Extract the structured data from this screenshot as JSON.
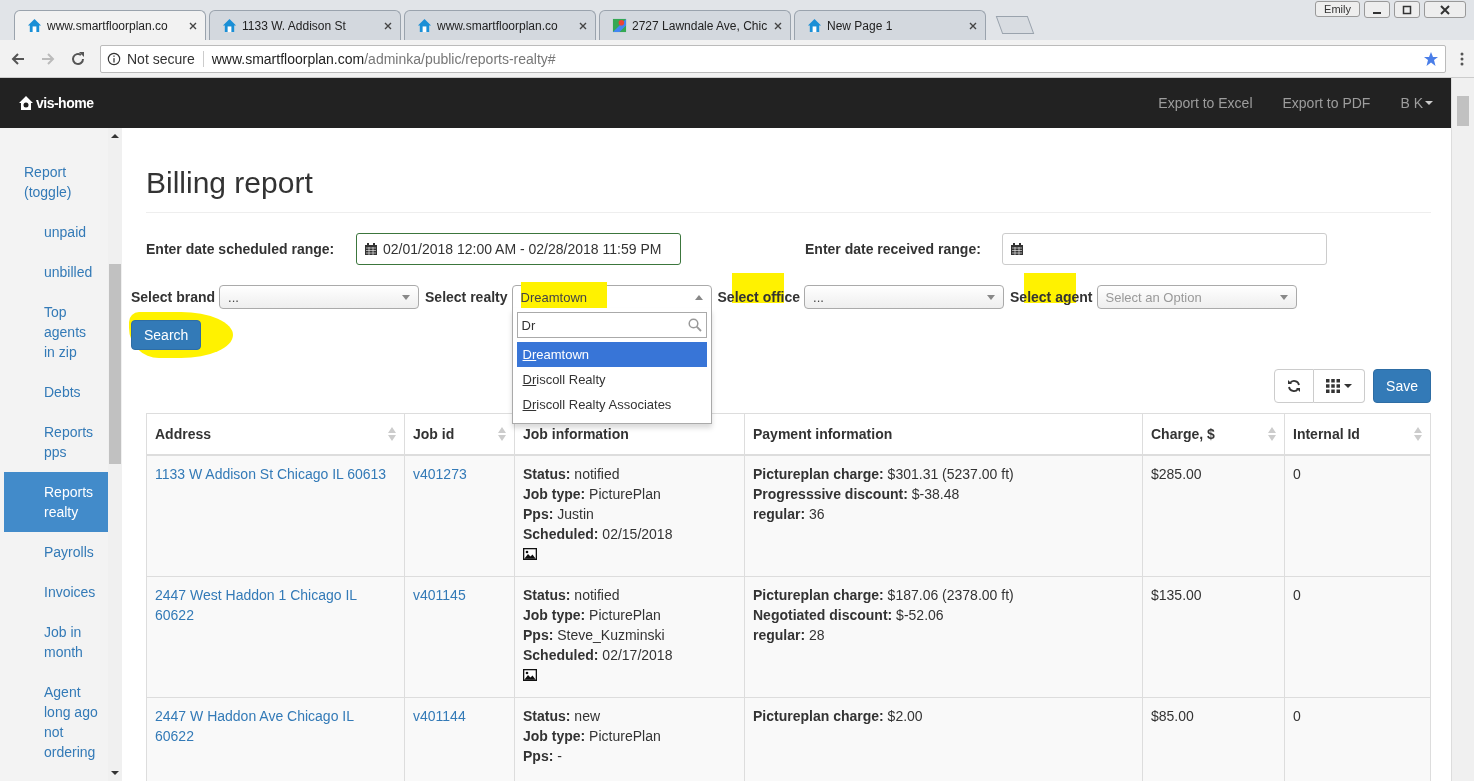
{
  "browser": {
    "tabs": [
      {
        "title": "www.smartfloorplan.co",
        "kind": "house",
        "selected": true
      },
      {
        "title": "1133 W. Addison St",
        "kind": "house",
        "selected": false
      },
      {
        "title": "www.smartfloorplan.co",
        "kind": "house",
        "selected": false
      },
      {
        "title": "2727 Lawndale Ave, Chic",
        "kind": "map",
        "selected": false
      },
      {
        "title": "New Page 1",
        "kind": "house",
        "selected": false
      }
    ],
    "user": "Emily",
    "security": "Not secure",
    "url_host": "www.smartfloorplan.com",
    "url_path": "/adminka/public/reports-realty#"
  },
  "navbar": {
    "brand": "vis-home",
    "links": [
      "Export to Excel",
      "Export to PDF"
    ],
    "user": "B K"
  },
  "sidebar": {
    "items": [
      {
        "label": "Report (toggle)",
        "selected": false,
        "children": [
          {
            "label": "unpaid",
            "selected": false
          },
          {
            "label": "unbilled",
            "selected": false
          },
          {
            "label": "Top agents in zip",
            "selected": false
          },
          {
            "label": "Debts",
            "selected": false
          },
          {
            "label": "Reports pps",
            "selected": false
          },
          {
            "label": "Reports realty",
            "selected": true
          },
          {
            "label": "Payrolls",
            "selected": false
          },
          {
            "label": "Invoices",
            "selected": false
          },
          {
            "label": "Job in month",
            "selected": false
          },
          {
            "label": "Agent long ago not ordering",
            "selected": false
          }
        ]
      }
    ]
  },
  "page": {
    "title": "Billing report",
    "date_scheduled": {
      "label": "Enter date scheduled range:",
      "value": "02/01/2018 12:00 AM - 02/28/2018 11:59 PM"
    },
    "date_received": {
      "label": "Enter date received range:"
    },
    "filters": [
      {
        "label": "Select brand",
        "value": "...",
        "open": false,
        "highlighted": false
      },
      {
        "label": "Select realty",
        "value": "Dreamtown",
        "open": true,
        "highlighted": true
      },
      {
        "label": "Select office",
        "value": "...",
        "open": false,
        "highlighted": true
      },
      {
        "label": "Select agent",
        "placeholder": "Select an Option",
        "open": false,
        "highlighted": true
      }
    ],
    "dropdown": {
      "search": "Dr",
      "options": [
        {
          "match": "Dr",
          "rest": "eamtown",
          "selected": true
        },
        {
          "match": "Dr",
          "rest": "iscoll Realty",
          "selected": false
        },
        {
          "match": "Dr",
          "rest": "iscoll Realty Associates",
          "selected": false
        }
      ]
    },
    "search_button": {
      "label": "Search",
      "highlighted": true
    },
    "save_button": "Save"
  },
  "table": {
    "columns": [
      {
        "label": "Address",
        "sortable": true
      },
      {
        "label": "Job id",
        "sortable": true
      },
      {
        "label": "Job information",
        "sortable": false
      },
      {
        "label": "Payment information",
        "sortable": false
      },
      {
        "label": "Charge, $",
        "sortable": true
      },
      {
        "label": "Internal Id",
        "sortable": true
      }
    ],
    "rows": [
      {
        "address": "1133 W Addison St Chicago IL 60613",
        "job_id": "v401273",
        "job_info": [
          "**Status:** notified",
          "**Job type:** PicturePlan",
          "**Pps:** Justin",
          "**Scheduled:** 02/15/2018"
        ],
        "has_photo": true,
        "payment": [
          "**Pictureplan charge:** $301.31 (5237.00 ft)",
          "**Progresssive discount:** $-38.48",
          "**regular:** 36"
        ],
        "charge": "$285.00",
        "internal_id": "0"
      },
      {
        "address": "2447 West Haddon 1 Chicago IL 60622",
        "job_id": "v401145",
        "job_info": [
          "**Status:** notified",
          "**Job type:** PicturePlan",
          "**Pps:** Steve_Kuzminski",
          "**Scheduled:** 02/17/2018"
        ],
        "has_photo": true,
        "payment": [
          "**Pictureplan charge:** $187.06 (2378.00 ft)",
          "**Negotiated discount:** $-52.06",
          "**regular:** 28"
        ],
        "charge": "$135.00",
        "internal_id": "0"
      },
      {
        "address": "2447 W Haddon Ave Chicago IL 60622",
        "job_id": "v401144",
        "job_info": [
          "**Status:** new",
          "**Job type:** PicturePlan",
          "**Pps:** -"
        ],
        "has_photo": false,
        "payment": [
          "**Pictureplan charge:** $2.00"
        ],
        "charge": "$85.00",
        "internal_id": "0"
      }
    ]
  }
}
